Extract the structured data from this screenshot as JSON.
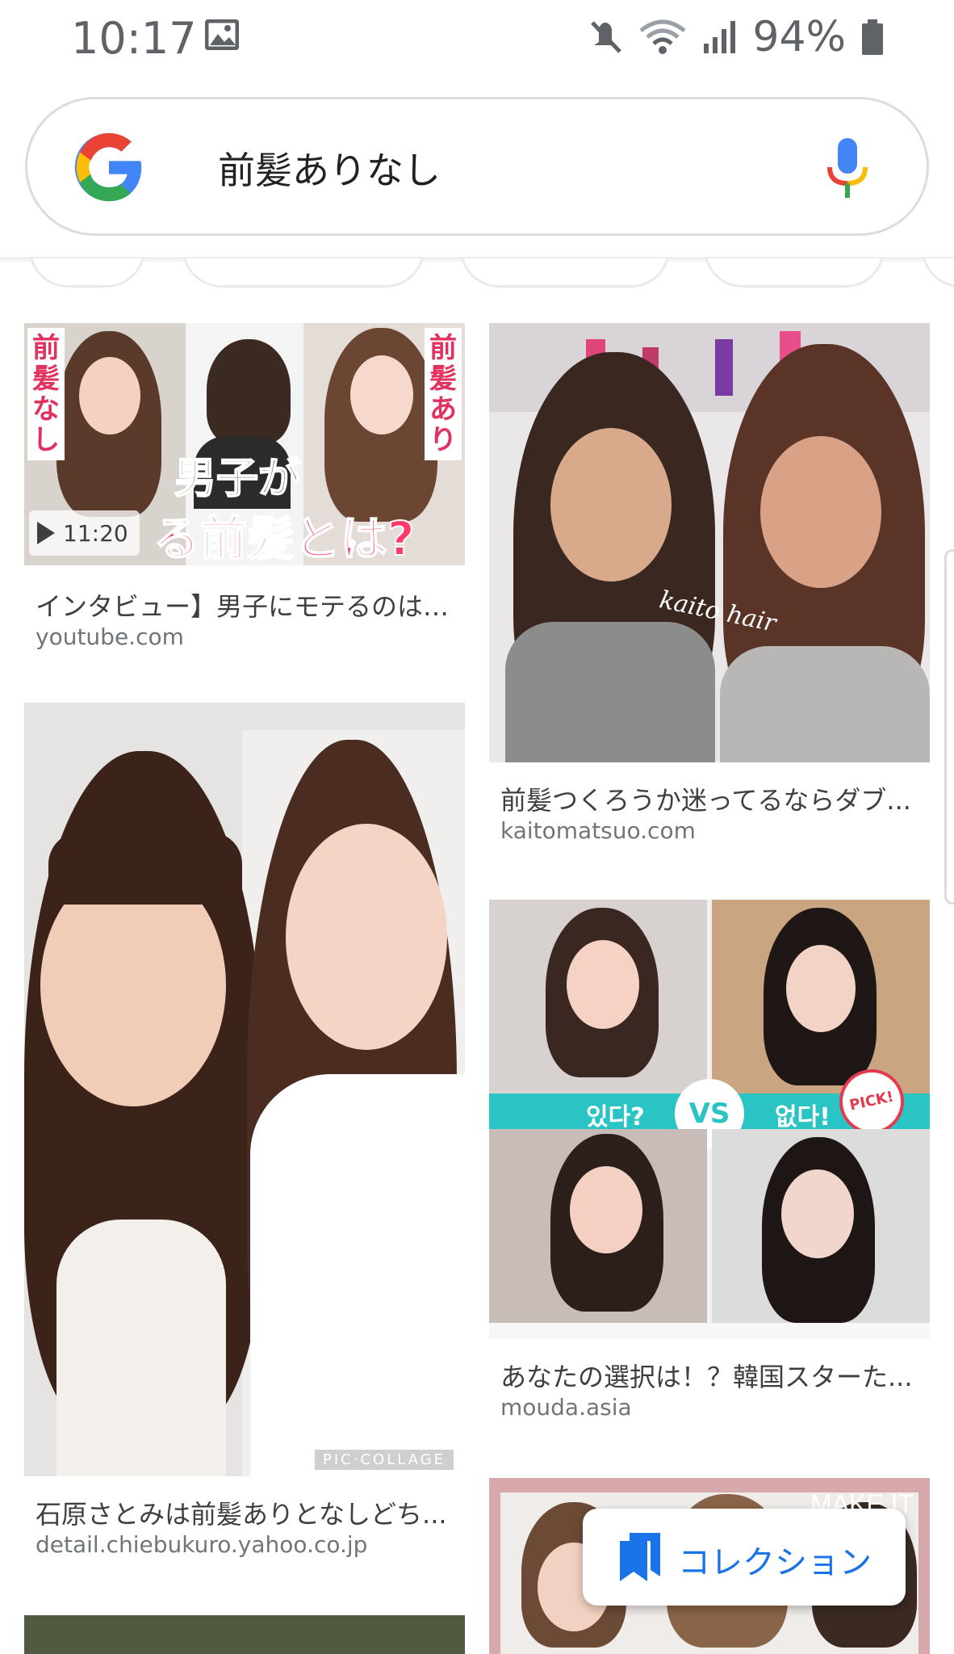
{
  "status_bar": {
    "time": "10:17",
    "battery": "94%",
    "icons": [
      "gallery-icon",
      "mute-icon",
      "wifi-icon",
      "signal-icon",
      "battery-icon"
    ]
  },
  "search": {
    "query": "前髪ありなし",
    "logo": "google-g-icon",
    "mic": "mic-icon"
  },
  "results": [
    {
      "title": "インタビュー】男子にモテるのは ...",
      "source": "youtube.com",
      "duration": "11:20",
      "overlay": {
        "left_label": "前髪なし",
        "right_label": "前髪あり",
        "headline_top": "男子が",
        "headline_bottom": "る前髪とは?"
      }
    },
    {
      "title": "前髪つくろうか迷ってるならダブ...",
      "source": "kaitomatsuo.com",
      "overlay": {
        "watermark": "kaito hair"
      }
    },
    {
      "title": "石原さとみは前髪ありとなしどち...",
      "source": "detail.chiebukuro.yahoo.co.jp",
      "overlay": {
        "watermark": "PIC·COLLAGE"
      }
    },
    {
      "title": "あなたの選択は！？韓国スターた...",
      "source": "mouda.asia",
      "overlay": {
        "left": "있다?",
        "center": "VS",
        "right": "없다!",
        "badge": "PICK!"
      }
    },
    {
      "overlay": {
        "watermark": "MAKE IT"
      }
    }
  ],
  "collection_button": {
    "label": "コレクション",
    "icon": "bookmark-icon"
  },
  "colors": {
    "accent": "#1a73e8",
    "teal_band": "#2bc4c4",
    "pink_text": "#ff3b6b"
  }
}
